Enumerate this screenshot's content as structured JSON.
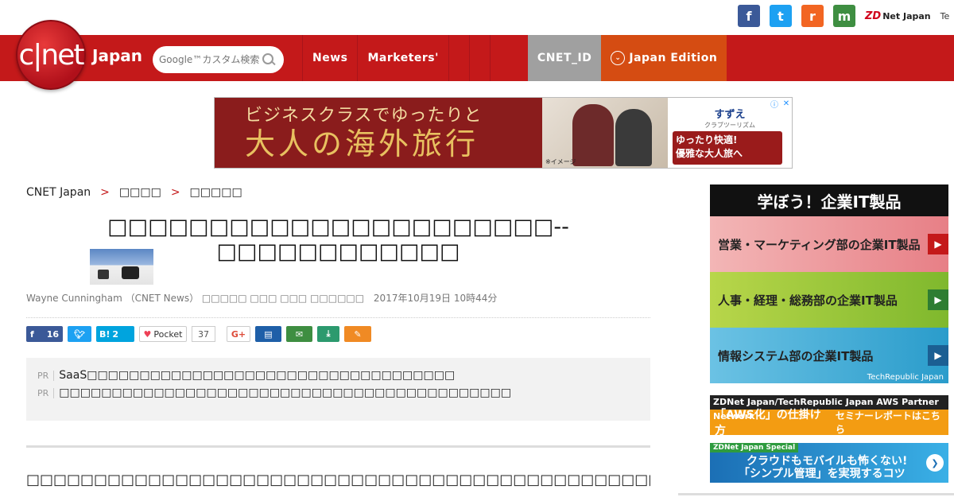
{
  "social": {
    "fb": "f",
    "tw": "t",
    "rss": "r",
    "mail": "m",
    "zdnet": "Net Japan",
    "zdmark": "ZD",
    "techrepublic": "Te"
  },
  "header": {
    "logo_text": "c|net",
    "logo_sub": "Japan",
    "search_placeholder": "Google™カスタム検索",
    "nav": [
      {
        "label": "News"
      },
      {
        "label": "Marketers'"
      },
      {
        "label": ""
      },
      {
        "label": ""
      },
      {
        "label": ""
      }
    ],
    "cnet_id": "CNET_ID",
    "edition": "Japan Edition"
  },
  "ad": {
    "line1": "ビジネスクラスでゆったりと",
    "line2": "大人の海外旅行",
    "note": "※イメージ",
    "brand": "すずえ",
    "brand2": "クラブツーリズム",
    "cta_line1": "ゆったり快適!",
    "cta_line2": "優雅な大人旅へ"
  },
  "breadcrumb": {
    "home": "CNET Japan",
    "cat": "□□□□",
    "sub": "□□□□□"
  },
  "article": {
    "title": "□□□□□□□□□□□□□□□□□□□□□□--□□□□□□□□□□□□",
    "byline": "Wayne Cunningham （CNET News） □□□□□ □□□ □□□ □□□□□□",
    "date": "2017年10月19日 10時44分"
  },
  "share": {
    "fb_count": "16",
    "hatena_count": "2",
    "pocket_label": "Pocket",
    "pocket_count": "37",
    "gplus": "G+"
  },
  "pr": [
    {
      "tag": "PR",
      "text": "SaaS□□□□□□□□□□□□□□□□□□□□□□□□□□□□□□□□□□□"
    },
    {
      "tag": "PR",
      "text": "□□□□□□□□□□□□□□□□□□□□□□□□□□□□□□□□□□□□□□□□□□□"
    }
  ],
  "body_text": "□□□□□□□□□□□□□□□□□□□□□□□□□□□□□□□□□□□□□□□□□□□□□□□□□□□□□□□□□□□□□□□□□□□□□□□□□□□□□□□□□□Apple□□□□□□□",
  "sidebar": {
    "head": "学ぼう！企業IT製品",
    "items": [
      {
        "label": "営業・マーケティング部の企業IT製品"
      },
      {
        "label": "人事・経理・総務部の企業IT製品"
      },
      {
        "label": "情報システム部の企業IT製品"
      }
    ],
    "tr_label": "TechRepublic Japan",
    "aws_title": "ZDNet Japan/TechRepublic Japan  AWS Partner Network",
    "aws_main": "「AWS化」の仕掛け方",
    "aws_sub": "セミナーレポートはこちら",
    "zds_tag": "ZDNet Japan Special",
    "zds_line1": "クラウドもモバイルも怖くない!",
    "zds_line2": "「シンプル管理」を実現するコツ"
  }
}
